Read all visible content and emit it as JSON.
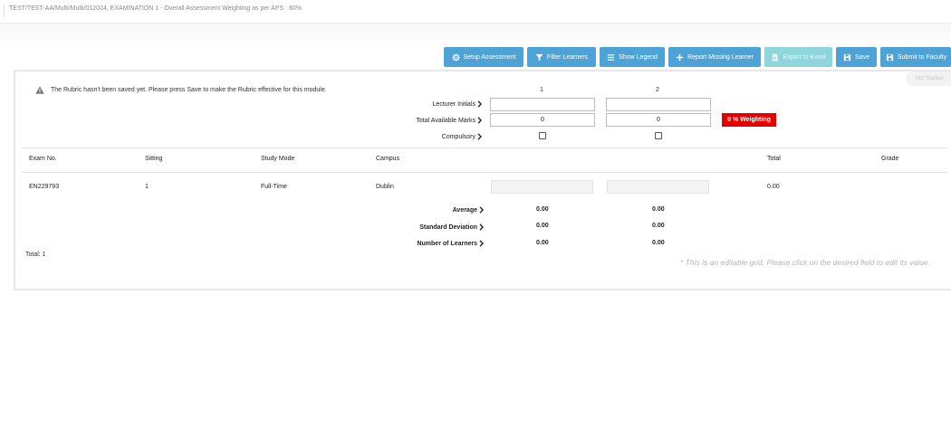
{
  "breadcrumb": "TEST/TEST-AA/Multi/Multi/012024, EXAMINATION 1 - Overall Assessment Weighting as per APS : 80%",
  "toolbar": {
    "setup_assessment": "Setup Assessment",
    "filter_learners": "Filter Learners",
    "show_legend": "Show Legend",
    "report_missing_learner": "Report Missing Learner",
    "export_to_excel": "Export to Excel",
    "save": "Save",
    "submit_to_faculty": "Submit to Faculty"
  },
  "status_tag": "Not Started",
  "warning": "The Rubric hasn't been saved yet. Please press Save to make the Rubric effective for this module.",
  "rubric": {
    "columns": [
      "1",
      "2"
    ],
    "lecturer_initials_label": "Lecturer Initials",
    "lecturer_initials": [
      "",
      ""
    ],
    "total_available_marks_label": "Total Available Marks",
    "total_available_marks": [
      "0",
      "0"
    ],
    "compulsory_label": "Compulsory",
    "weighting_badge": "0 % Weighting"
  },
  "grid": {
    "headers": {
      "exam_no": "Exam No.",
      "sitting": "Sitting",
      "study_mode": "Study Mode",
      "campus": "Campus",
      "total": "Total",
      "grade": "Grade"
    },
    "rows": [
      {
        "exam_no": "EN229793",
        "sitting": "1",
        "study_mode": "Full-Time",
        "campus": "Dublin",
        "total": "0.00",
        "grade": ""
      }
    ]
  },
  "stats": {
    "average_label": "Average",
    "average": [
      "0.00",
      "0.00"
    ],
    "std_dev_label": "Standard Deviation",
    "std_dev": [
      "0.00",
      "0.00"
    ],
    "num_learners_label": "Number of Learners",
    "num_learners": [
      "0.00",
      "0.00"
    ]
  },
  "total_count": "Total: 1",
  "hint": "* This is an editable grid. Please click on the desired field to edit its value.",
  "colors": {
    "button": "#4da3d6",
    "button_disabled": "#8fd6dc",
    "badge": "#e60000"
  }
}
